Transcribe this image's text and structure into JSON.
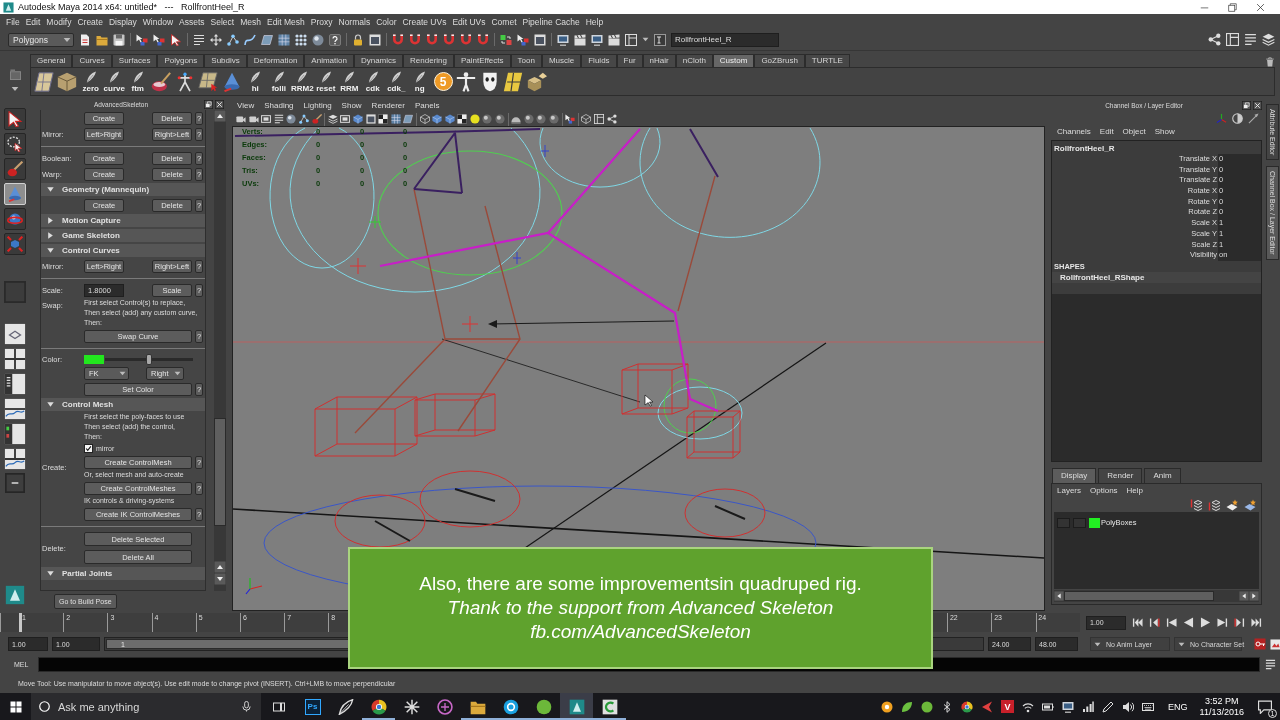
{
  "window": {
    "title": "Autodesk Maya 2014 x64: untitled*   ---   RollfrontHeel_R"
  },
  "menu_bar": [
    "File",
    "Edit",
    "Modify",
    "Create",
    "Display",
    "Window",
    "Assets",
    "Select",
    "Mesh",
    "Edit Mesh",
    "Proxy",
    "Normals",
    "Color",
    "Create UVs",
    "Edit UVs",
    "Comet",
    "Pipeline Cache",
    "Help"
  ],
  "status_line": {
    "menu_set": "Polygons",
    "name_field": "RollfrontHeel_R"
  },
  "shelf": {
    "tabs": [
      {
        "label": "General",
        "selected": false
      },
      {
        "label": "Curves",
        "selected": false
      },
      {
        "label": "Surfaces",
        "selected": false
      },
      {
        "label": "Polygons",
        "selected": false
      },
      {
        "label": "Subdivs",
        "selected": false
      },
      {
        "label": "Deformation",
        "selected": false
      },
      {
        "label": "Animation",
        "selected": false
      },
      {
        "label": "Dynamics",
        "selected": false
      },
      {
        "label": "Rendering",
        "selected": false
      },
      {
        "label": "PaintEffects",
        "selected": false
      },
      {
        "label": "Toon",
        "selected": false
      },
      {
        "label": "Muscle",
        "selected": false
      },
      {
        "label": "Fluids",
        "selected": false
      },
      {
        "label": "Fur",
        "selected": false
      },
      {
        "label": "nHair",
        "selected": false
      },
      {
        "label": "nCloth",
        "selected": false
      },
      {
        "label": "Custom",
        "selected": true
      },
      {
        "label": "GoZBrush",
        "selected": false
      },
      {
        "label": "TURTLE",
        "selected": false
      }
    ],
    "items": [
      {
        "kind": "tool"
      },
      {
        "kind": "tool"
      },
      {
        "kind": "script",
        "label": "zero"
      },
      {
        "kind": "script",
        "label": "curve"
      },
      {
        "kind": "script",
        "label": "ftm"
      },
      {
        "kind": "tool"
      },
      {
        "kind": "tool"
      },
      {
        "kind": "tool"
      },
      {
        "kind": "tool"
      },
      {
        "kind": "script",
        "label": "hi"
      },
      {
        "kind": "script",
        "label": "folli"
      },
      {
        "kind": "script",
        "label": "RRM2"
      },
      {
        "kind": "script",
        "label": "reset"
      },
      {
        "kind": "script",
        "label": "RRM"
      },
      {
        "kind": "script",
        "label": "cdk"
      },
      {
        "kind": "script",
        "label": "cdk_"
      },
      {
        "kind": "script",
        "label": "ng"
      },
      {
        "kind": "badge",
        "label": "5"
      },
      {
        "kind": "tool"
      },
      {
        "kind": "tool"
      },
      {
        "kind": "tool"
      },
      {
        "kind": "tool"
      }
    ]
  },
  "toolbox": [
    {
      "selected": false
    },
    {
      "selected": false
    },
    {
      "selected": false
    },
    {
      "selected": true
    },
    {
      "selected": false
    },
    {
      "selected": false
    }
  ],
  "advanced_skeleton": {
    "title": "AdvancedSkeleton",
    "rows": [
      {
        "kind": "row",
        "buttons": [
          "Create",
          "Delete"
        ],
        "help": "?"
      },
      {
        "kind": "row",
        "label": "Mirror:",
        "buttons": [
          "Left>Right",
          "Right>Left"
        ],
        "help": "?"
      },
      {
        "kind": "separator"
      },
      {
        "kind": "row",
        "label": "Boolean:",
        "buttons": [
          "Create",
          "Delete"
        ],
        "help": "?"
      },
      {
        "kind": "row",
        "label": "Warp:",
        "buttons": [
          "Create",
          "Delete"
        ],
        "help": "?"
      },
      {
        "kind": "section",
        "title": "Geometry (Mannequin)",
        "expanded": true
      },
      {
        "kind": "row",
        "buttons": [
          "Create",
          "Delete"
        ],
        "help": "?"
      },
      {
        "kind": "section",
        "title": "Motion Capture",
        "expanded": false
      },
      {
        "kind": "section",
        "title": "Game Skeleton",
        "expanded": false
      },
      {
        "kind": "section",
        "title": "Control Curves",
        "expanded": true
      },
      {
        "kind": "row",
        "label": "Mirror:",
        "buttons": [
          "Left>Right",
          "Right>Left"
        ],
        "help": "?"
      },
      {
        "kind": "separator"
      },
      {
        "kind": "field",
        "label": "Scale:",
        "value": "1.8000",
        "button": "Scale",
        "help": "?"
      },
      {
        "kind": "block",
        "label": "Swap:",
        "items": [
          {
            "kind": "note",
            "text": "First select Control(s) to replace,\nThen select (add) any custom curve,\nThen:"
          },
          {
            "kind": "wide",
            "button": "Swap Curve",
            "help": "?"
          }
        ]
      },
      {
        "kind": "separator"
      },
      {
        "kind": "block",
        "label": "Color:",
        "items": [
          {
            "kind": "color",
            "color": "#22e61e",
            "level": 0.5
          },
          {
            "kind": "dropdowns",
            "options": [
              "FK",
              "Right"
            ]
          },
          {
            "kind": "wide",
            "button": "Set Color",
            "help": "?"
          }
        ]
      },
      {
        "kind": "section",
        "title": "Control Mesh",
        "expanded": true
      },
      {
        "kind": "stack",
        "label": "Create:",
        "items": [
          {
            "kind": "note",
            "text": "First select the poly-faces to use\nThen select (add) the control,\nThen:"
          },
          {
            "kind": "checkbox",
            "label": "mirror",
            "checked": true
          },
          {
            "kind": "wide",
            "button": "Create ControlMesh",
            "help": "?"
          },
          {
            "kind": "note",
            "text": "Or, select mesh and auto-create"
          },
          {
            "kind": "wide",
            "button": "Create ControlMeshes",
            "help": "?"
          },
          {
            "kind": "note",
            "text": "IK controls & driving-systems"
          },
          {
            "kind": "wide",
            "button": "Create IK ControlMeshes",
            "help": "?"
          }
        ]
      },
      {
        "kind": "separator"
      },
      {
        "kind": "stack",
        "label": "Delete:",
        "items": [
          {
            "kind": "wide",
            "button": "Delete Selected"
          },
          {
            "kind": "wide",
            "button": "Delete All"
          }
        ]
      },
      {
        "kind": "section",
        "title": "Partial Joints",
        "expanded": true
      }
    ],
    "footer_button": "Go to Build Pose"
  },
  "viewport": {
    "menu": [
      "View",
      "Shading",
      "Lighting",
      "Show",
      "Renderer",
      "Panels"
    ],
    "hud": [
      {
        "label": "Verts:",
        "values": [
          "0",
          "0",
          "0"
        ]
      },
      {
        "label": "Edges:",
        "values": [
          "0",
          "0",
          "0"
        ]
      },
      {
        "label": "Faces:",
        "values": [
          "0",
          "0",
          "0"
        ]
      },
      {
        "label": "Tris:",
        "values": [
          "0",
          "0",
          "0"
        ]
      },
      {
        "label": "UVs:",
        "values": [
          "0",
          "0",
          "0"
        ]
      }
    ]
  },
  "channel_box": {
    "title": "Channel Box / Layer Editor",
    "menu": [
      "Channels",
      "Edit",
      "Object",
      "Show"
    ],
    "object": "RollfrontHeel_R",
    "channels": [
      {
        "name": "Translate X",
        "value": "0"
      },
      {
        "name": "Translate Y",
        "value": "0"
      },
      {
        "name": "Translate Z",
        "value": "0"
      },
      {
        "name": "Rotate X",
        "value": "0"
      },
      {
        "name": "Rotate Y",
        "value": "0"
      },
      {
        "name": "Rotate Z",
        "value": "0"
      },
      {
        "name": "Scale X",
        "value": "1"
      },
      {
        "name": "Scale Y",
        "value": "1"
      },
      {
        "name": "Scale Z",
        "value": "1"
      },
      {
        "name": "Visibility",
        "value": "on"
      }
    ],
    "shapes_heading": "SHAPES",
    "shape": "RollfrontHeel_RShape"
  },
  "layer_editor": {
    "tabs": [
      {
        "label": "Display",
        "selected": true
      },
      {
        "label": "Render",
        "selected": false
      },
      {
        "label": "Anim",
        "selected": false
      }
    ],
    "menu": [
      "Layers",
      "Options",
      "Help"
    ],
    "layers": [
      {
        "name": "PolyBoxes",
        "color": "#22ee22"
      }
    ]
  },
  "side_tabs": [
    {
      "label": "Attribute Editor",
      "selected": false
    },
    {
      "label": "Channel Box / Layer Editor",
      "selected": true
    }
  ],
  "time_slider": {
    "ticks_start": [
      "1",
      "2",
      "3",
      "4",
      "5",
      "6",
      "7",
      "8"
    ],
    "ticks_end": [
      "22",
      "23",
      "24"
    ],
    "level": 0,
    "current_frame": "1.00"
  },
  "range_slider": {
    "start": "1.00",
    "range_start": "1.00",
    "range_handle": "1",
    "level": 0.5,
    "range_end": "24.00",
    "end": "48.00",
    "anim_layer": "No Anim Layer",
    "character_set": "No Character Set"
  },
  "command_line": {
    "language": "MEL"
  },
  "help_line": "Move Tool: Use manipulator to move object(s). Use edit mode to change pivot (INSERT).  Ctrl+LMB to move perpendicular",
  "caption": {
    "lines": [
      {
        "text": "Also, there are some improvementsin quadruped rig.",
        "italic": false
      },
      {
        "text": "Thank to the support from Advanced Skeleton",
        "italic": true
      },
      {
        "text": "fb.com/AdvancedSkeleton",
        "italic": true
      }
    ]
  },
  "taskbar": {
    "search_placeholder": "Ask me anything",
    "apps": [
      {
        "kind": "text",
        "label": "Ps",
        "running": false,
        "selected": false
      },
      {
        "kind": "icon",
        "running": false,
        "selected": false
      },
      {
        "kind": "icon",
        "running": true,
        "selected": false
      },
      {
        "kind": "icon",
        "running": false,
        "selected": false
      },
      {
        "kind": "icon",
        "running": false,
        "selected": false
      },
      {
        "kind": "icon",
        "running": true,
        "selected": false
      },
      {
        "kind": "icon",
        "running": true,
        "selected": false
      },
      {
        "kind": "icon",
        "running": true,
        "selected": false
      },
      {
        "kind": "icon",
        "running": true,
        "selected": true
      },
      {
        "kind": "icon",
        "running": true,
        "selected": false
      }
    ],
    "tray": [
      {
        "kind": "icon"
      },
      {
        "kind": "icon"
      },
      {
        "kind": "icon"
      },
      {
        "kind": "icon"
      },
      {
        "kind": "icon"
      },
      {
        "kind": "icon"
      },
      {
        "kind": "text",
        "label": "V"
      },
      {
        "kind": "icon"
      },
      {
        "kind": "icon"
      },
      {
        "kind": "icon"
      },
      {
        "kind": "icon"
      },
      {
        "kind": "icon"
      },
      {
        "kind": "icon"
      },
      {
        "kind": "icon"
      }
    ],
    "language": "ENG",
    "time": "3:52 PM",
    "date": "11/13/2016",
    "notification_count": "1"
  }
}
